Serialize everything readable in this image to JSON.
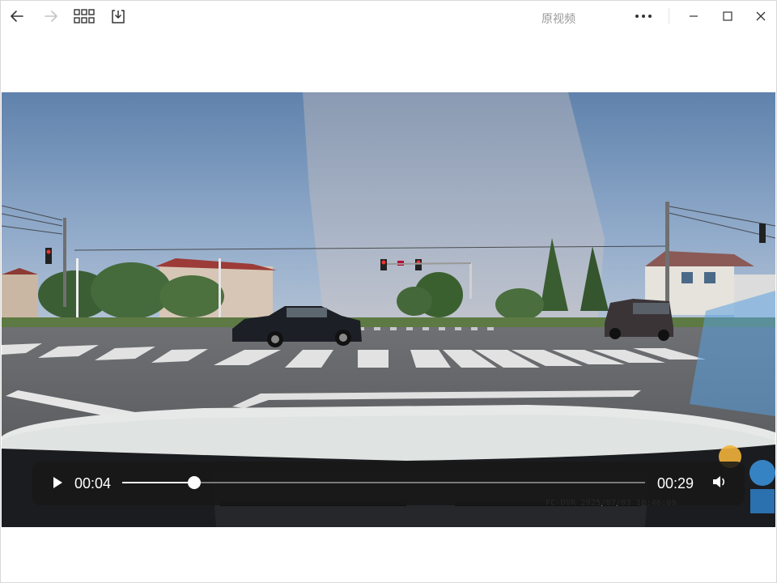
{
  "app": {
    "title": "原视频"
  },
  "toolbar": {
    "back_icon": "arrow-left-icon",
    "forward_icon": "arrow-right-icon",
    "grid_icon": "grid-icon",
    "save_icon": "download-icon"
  },
  "window_controls": [
    "more-icon",
    "minimize-icon",
    "maximize-icon",
    "close-icon"
  ],
  "video": {
    "overlay_text": "FC-DVR 2025/07/03 10:46:09"
  },
  "player": {
    "current_time": "00:04",
    "duration": "00:29",
    "progress_fraction": 0.138,
    "play_icon": "play-icon",
    "volume_icon": "volume-icon"
  },
  "colors": {
    "sky": "#6f8fb4",
    "road": "#5f6164",
    "control_bar": "#181818",
    "hood": "#e6e9e7"
  }
}
